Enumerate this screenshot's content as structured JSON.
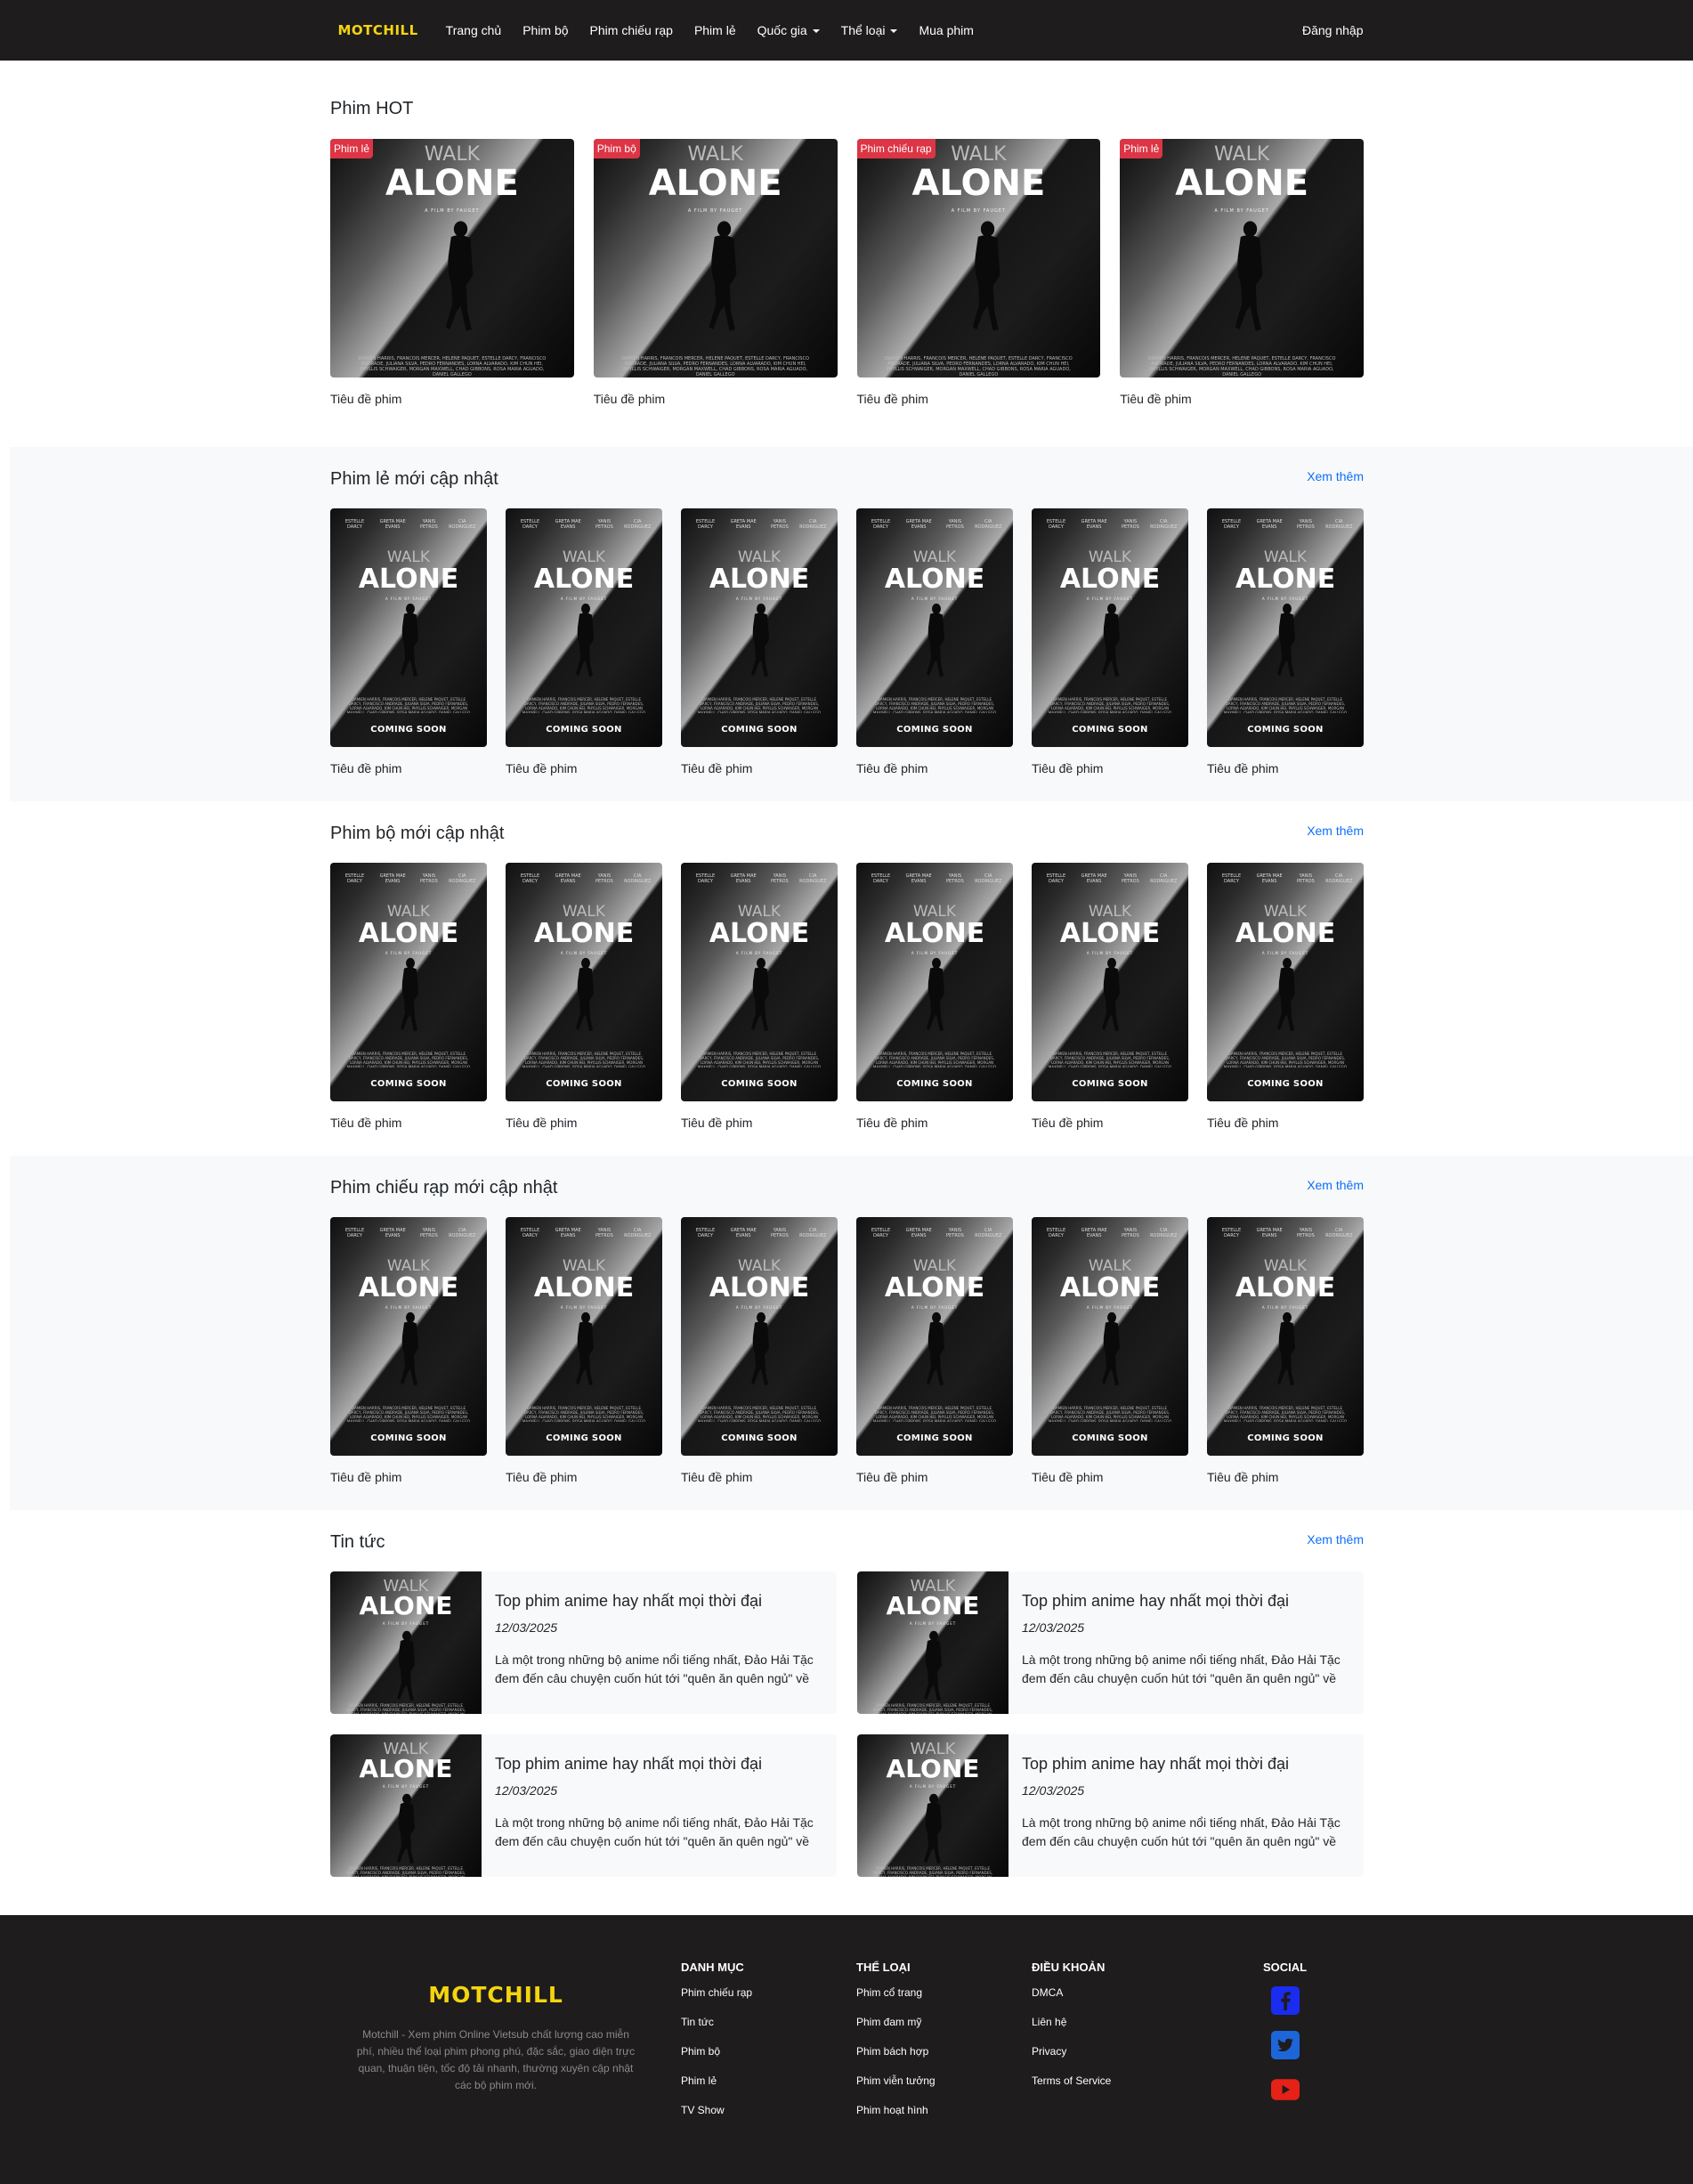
{
  "nav": {
    "brand": "MOTCHILL",
    "links": [
      {
        "label": "Trang chủ"
      },
      {
        "label": "Phim bộ"
      },
      {
        "label": "Phim chiếu rạp"
      },
      {
        "label": "Phim lẻ"
      },
      {
        "label": "Quốc gia"
      },
      {
        "label": "Thể loại"
      },
      {
        "label": "Mua phim"
      }
    ],
    "login": "Đăng nhập"
  },
  "poster": {
    "walk": "WALK",
    "alone": "ALONE",
    "sub": "A FILM BY FAUGET",
    "cast": [
      "ESTELLE DARCY",
      "GRETA MAE EVANS",
      "YANIS PETROS",
      "CIA RODRIGUEZ"
    ],
    "credits": "DAMIEN HARRIS, FRANCOIS MERCER, HELENE PAQUET, ESTELLE DARCY, FRANCISCO ANDRADE, JULIANA SILVA, PEDRO FERNANDES, LORNA ALVARADO, KIM CHUN HEI, PHYLLIS SCHWAIGER, MORGAN MAXWELL, CHAD GIBBONS, ROSA MARIA AGUADO, DANIEL GALLEGO",
    "coming_soon": "COMING SOON"
  },
  "hot": {
    "title": "Phim HOT",
    "items": [
      {
        "badge": "Phim lẻ",
        "title": "Tiêu đề phim"
      },
      {
        "badge": "Phim bộ",
        "title": "Tiêu đề phim"
      },
      {
        "badge": "Phim chiếu rạp",
        "title": "Tiêu đề phim"
      },
      {
        "badge": "Phim lẻ",
        "title": "Tiêu đề phim"
      }
    ]
  },
  "sections": [
    {
      "title": "Phim lẻ mới cập nhật",
      "more": "Xem thêm",
      "items": [
        "Tiêu đề phim",
        "Tiêu đề phim",
        "Tiêu đề phim",
        "Tiêu đề phim",
        "Tiêu đề phim",
        "Tiêu đề phim"
      ]
    },
    {
      "title": "Phim bộ mới cập nhật",
      "more": "Xem thêm",
      "items": [
        "Tiêu đề phim",
        "Tiêu đề phim",
        "Tiêu đề phim",
        "Tiêu đề phim",
        "Tiêu đề phim",
        "Tiêu đề phim"
      ]
    },
    {
      "title": "Phim chiếu rạp mới cập nhật",
      "more": "Xem thêm",
      "items": [
        "Tiêu đề phim",
        "Tiêu đề phim",
        "Tiêu đề phim",
        "Tiêu đề phim",
        "Tiêu đề phim",
        "Tiêu đề phim"
      ]
    }
  ],
  "news": {
    "title": "Tin tức",
    "more": "Xem thêm",
    "items": [
      {
        "title": "Top phim anime hay nhất mọi thời đại",
        "date": "12/03/2025",
        "text": "Là một trong những bộ anime nổi tiếng nhất, Đảo Hải Tặc đem đến câu chuyện cuốn hút tới \"quên ăn quên ngủ\" về"
      },
      {
        "title": "Top phim anime hay nhất mọi thời đại",
        "date": "12/03/2025",
        "text": "Là một trong những bộ anime nổi tiếng nhất, Đảo Hải Tặc đem đến câu chuyện cuốn hút tới \"quên ăn quên ngủ\" về"
      },
      {
        "title": "Top phim anime hay nhất mọi thời đại",
        "date": "12/03/2025",
        "text": "Là một trong những bộ anime nổi tiếng nhất, Đảo Hải Tặc đem đến câu chuyện cuốn hút tới \"quên ăn quên ngủ\" về"
      },
      {
        "title": "Top phim anime hay nhất mọi thời đại",
        "date": "12/03/2025",
        "text": "Là một trong những bộ anime nổi tiếng nhất, Đảo Hải Tặc đem đến câu chuyện cuốn hút tới \"quên ăn quên ngủ\" về"
      }
    ]
  },
  "footer": {
    "logo": "MOTCHILL",
    "desc": "Motchill - Xem phim Online Vietsub chất lượng cao miễn phí, nhiều thể loại phim phong phú, đặc sắc, giao diện trực quan, thuận tiện, tốc độ tải nhanh, thường xuyên cập nhật các bộ phim mới.",
    "cols": [
      {
        "heading": "DANH MỤC",
        "links": [
          "Phim chiếu rạp",
          "Tin tức",
          "Phim bộ",
          "Phim lẻ",
          "TV Show"
        ]
      },
      {
        "heading": "THỂ LOẠI",
        "links": [
          "Phim cổ trang",
          "Phim đam mỹ",
          "Phim bách hợp",
          "Phim viễn tưởng",
          "Phim hoạt hình"
        ]
      },
      {
        "heading": "ĐIỀU KHOẢN",
        "links": [
          "DMCA",
          "Liên hệ",
          "Privacy",
          "Terms of Service"
        ]
      }
    ],
    "social": {
      "heading": "SOCIAL",
      "icons": [
        "facebook-icon",
        "twitter-icon",
        "youtube-icon"
      ]
    }
  },
  "colors": {
    "brand": "#f5d40f",
    "navbar_bg": "#1e1c1c",
    "badge": "#dc3545",
    "link": "#0d6efd",
    "facebook": "#1a2cf0",
    "twitter": "#1d66d9",
    "youtube": "#e62117"
  }
}
